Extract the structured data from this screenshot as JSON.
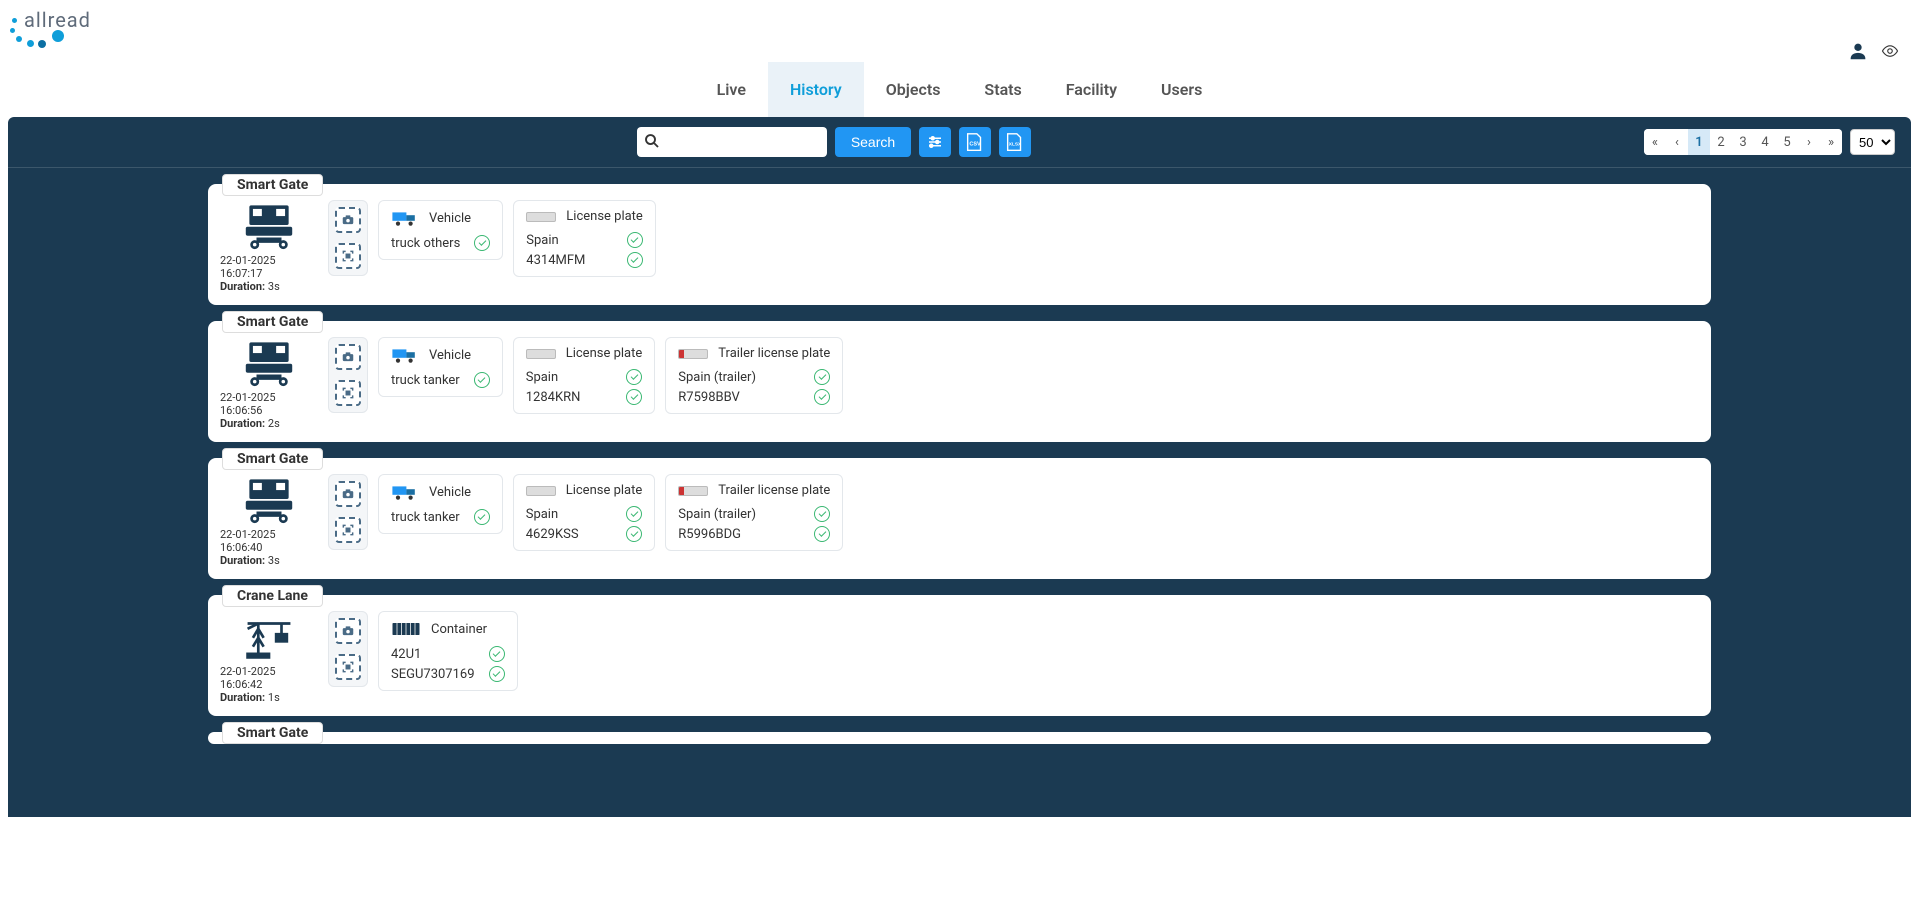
{
  "brand": "allread",
  "nav": [
    {
      "label": "Live",
      "active": false
    },
    {
      "label": "History",
      "active": true
    },
    {
      "label": "Objects",
      "active": false
    },
    {
      "label": "Stats",
      "active": false
    },
    {
      "label": "Facility",
      "active": false
    },
    {
      "label": "Users",
      "active": false
    }
  ],
  "search": {
    "placeholder": "",
    "button": "Search"
  },
  "pagination": {
    "pages": [
      "1",
      "2",
      "3",
      "4",
      "5"
    ],
    "active": "1",
    "perPage": "50"
  },
  "durationLabel": "Duration:",
  "records": [
    {
      "title": "Smart Gate",
      "icon": "truck",
      "timestamp": "22-01-2025 16:07:17",
      "duration": "3s",
      "cards": [
        {
          "type": "vehicle",
          "label": "Vehicle",
          "rows": [
            {
              "text": "truck others",
              "check": true
            }
          ]
        },
        {
          "type": "plate",
          "label": "License plate",
          "rows": [
            {
              "text": "Spain",
              "check": true
            },
            {
              "text": "4314MFM",
              "check": true
            }
          ]
        }
      ]
    },
    {
      "title": "Smart Gate",
      "icon": "truck",
      "timestamp": "22-01-2025 16:06:56",
      "duration": "2s",
      "cards": [
        {
          "type": "vehicle",
          "label": "Vehicle",
          "rows": [
            {
              "text": "truck tanker",
              "check": true
            }
          ]
        },
        {
          "type": "plate",
          "label": "License plate",
          "rows": [
            {
              "text": "Spain",
              "check": true
            },
            {
              "text": "1284KRN",
              "check": true
            }
          ]
        },
        {
          "type": "trailer",
          "label": "Trailer license plate",
          "rows": [
            {
              "text": "Spain (trailer)",
              "check": true
            },
            {
              "text": "R7598BBV",
              "check": true
            }
          ]
        }
      ]
    },
    {
      "title": "Smart Gate",
      "icon": "truck",
      "timestamp": "22-01-2025 16:06:40",
      "duration": "3s",
      "cards": [
        {
          "type": "vehicle",
          "label": "Vehicle",
          "rows": [
            {
              "text": "truck tanker",
              "check": true
            }
          ]
        },
        {
          "type": "plate",
          "label": "License plate",
          "rows": [
            {
              "text": "Spain",
              "check": true
            },
            {
              "text": "4629KSS",
              "check": true
            }
          ]
        },
        {
          "type": "trailer",
          "label": "Trailer license plate",
          "rows": [
            {
              "text": "Spain (trailer)",
              "check": true
            },
            {
              "text": "R5996BDG",
              "check": true
            }
          ]
        }
      ]
    },
    {
      "title": "Crane Lane",
      "icon": "crane",
      "timestamp": "22-01-2025 16:06:42",
      "duration": "1s",
      "cards": [
        {
          "type": "container",
          "label": "Container",
          "rows": [
            {
              "text": "42U1",
              "check": true
            },
            {
              "text": "SEGU7307169",
              "check": true
            }
          ]
        }
      ]
    },
    {
      "title": "Smart Gate",
      "icon": "truck",
      "timestamp": "",
      "duration": "",
      "cards": [],
      "partial": true
    }
  ]
}
